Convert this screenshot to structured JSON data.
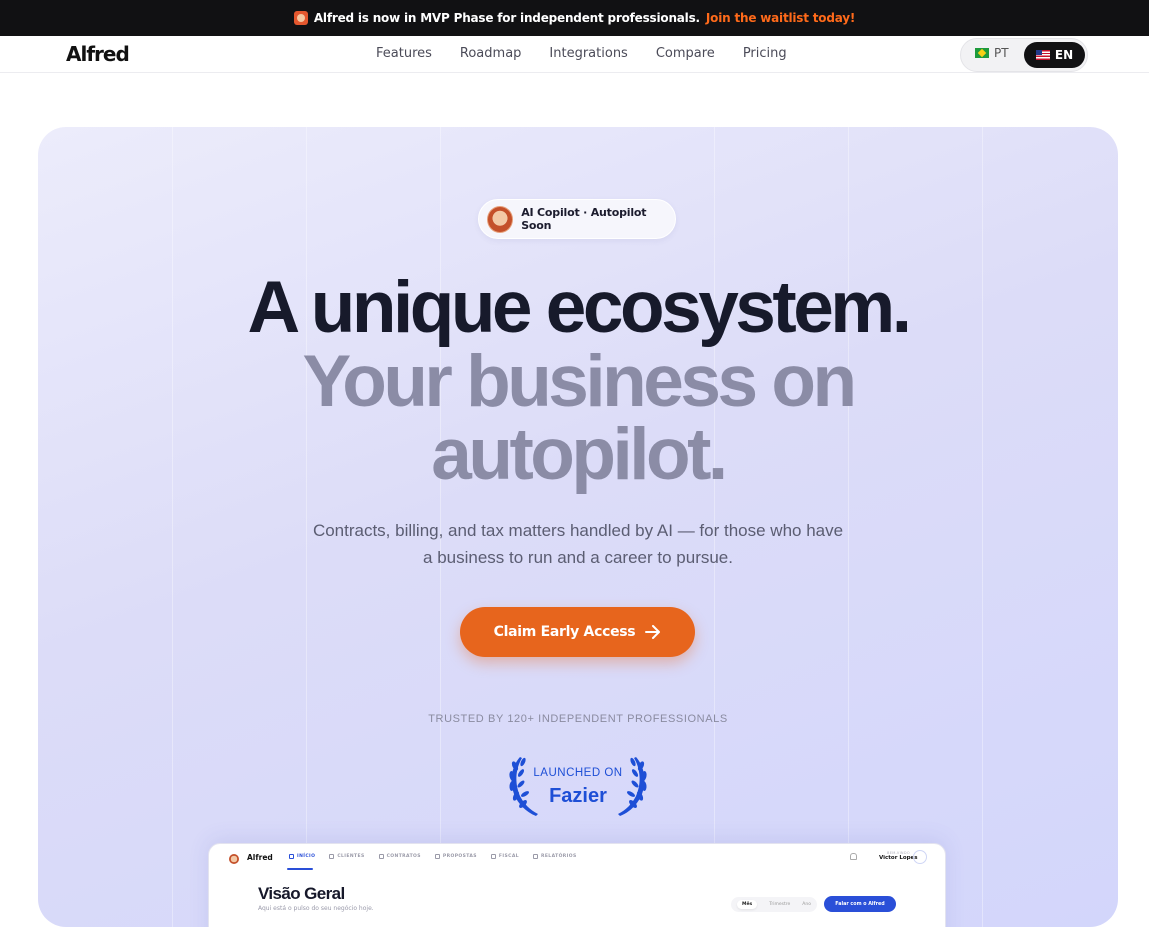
{
  "announcement": {
    "message": "Alfred is now in MVP Phase for independent professionals.",
    "cta": "Join the waitlist today!"
  },
  "nav": {
    "brand": "Alfred",
    "links": [
      "Features",
      "Roadmap",
      "Integrations",
      "Compare",
      "Pricing"
    ],
    "lang": {
      "pt": "PT",
      "en": "EN",
      "selected": "EN"
    }
  },
  "hero": {
    "pill": "AI Copilot · Autopilot Soon",
    "headline_line1": "A unique ecosystem.",
    "headline_line2": "Your business on",
    "headline_line3": "autopilot.",
    "subtitle": "Contracts, billing, and tax matters handled by AI — for those who have a business to run and a career to pursue.",
    "cta": "Claim Early Access",
    "trusted": "TRUSTED BY 120+ INDEPENDENT PROFESSIONALS",
    "badge_top": "LAUNCHED ON",
    "badge_name": "Fazier"
  },
  "preview": {
    "brand": "Alfred",
    "tabs": [
      "INÍCIO",
      "CLIENTES",
      "CONTRATOS",
      "PROPOSTAS",
      "FISCAL",
      "RELATÓRIOS"
    ],
    "active_tab": "INÍCIO",
    "user_caption": "BEM-VINDO",
    "user_name": "Victor Lopes",
    "title": "Visão Geral",
    "subtitle": "Aqui está o pulso do seu negócio hoje.",
    "periods": [
      "Mês",
      "Trimestre",
      "Ano"
    ],
    "selected_period": "Mês",
    "action_button": "Falar com o Alfred"
  },
  "colors": {
    "accent_orange": "#e7651d",
    "accent_blue": "#2a4fd8",
    "badge_blue": "#1e4fd6",
    "announce_bg": "#111113"
  }
}
